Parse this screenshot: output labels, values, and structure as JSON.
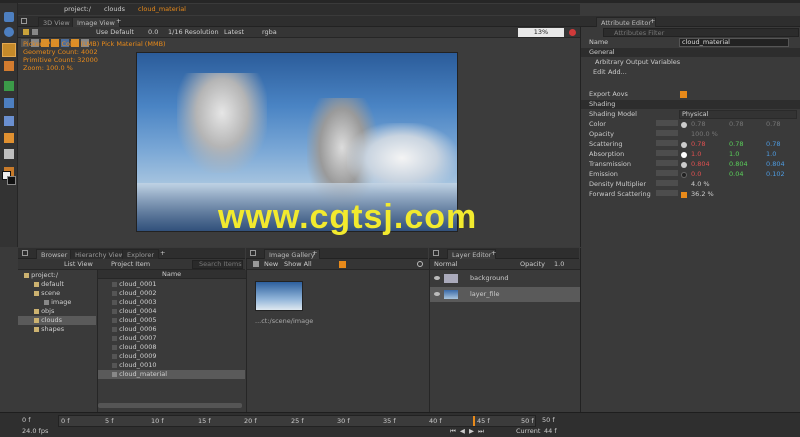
{
  "viewer": {
    "tabs": [
      "3D View",
      "Image View"
    ],
    "breadcrumb": [
      "project:/",
      "clouds",
      "cloud_material"
    ],
    "toolbar": {
      "shading": "Use Default",
      "exposure": "0.0",
      "resolution": "1/16 Resolution",
      "version": "Latest",
      "channels": "rgba",
      "zoom": "13%"
    },
    "overlay": [
      "Picker: Pick Color (LMB)  Pick Material (MMB)",
      "Geometry Count: 4002",
      "Primitive Count: 32000",
      "Zoom: 100.0 %"
    ],
    "watermark": "www.cgtsj.com"
  },
  "attribute_editor": {
    "tab": "Attribute Editor",
    "filter_placeholder": "Attributes Filter",
    "name_label": "Name",
    "name_value": "cloud_material",
    "general": "General",
    "aov": "Arbitrary Output Variables",
    "edit": "Edit",
    "add": "Add...",
    "export_aovs": "Export Aovs",
    "shading": "Shading",
    "shading_model_label": "Shading Model",
    "shading_model": "Physical",
    "rows": [
      {
        "label": "Color",
        "v1": "0.78",
        "v2": "0.78",
        "v3": "0.78",
        "dim": true
      },
      {
        "label": "Opacity",
        "v1": "100.0 %",
        "v2": "",
        "v3": "",
        "dim": true
      },
      {
        "label": "Scattering",
        "v1": "0.78",
        "v2": "0.78",
        "v3": "0.78"
      },
      {
        "label": "Absorption",
        "v1": "1.0",
        "v2": "1.0",
        "v3": "1.0"
      },
      {
        "label": "Transmission",
        "v1": "0.804",
        "v2": "0.804",
        "v3": "0.804"
      },
      {
        "label": "Emission",
        "v1": "0.0",
        "v2": "0.04",
        "v3": "0.102"
      },
      {
        "label": "Density Multiplier",
        "v1": "4.0 %",
        "v2": "",
        "v3": ""
      },
      {
        "label": "Forward Scattering",
        "v1": "36.2 %",
        "v2": "",
        "v3": ""
      }
    ],
    "colors": {
      "red": "#e05050",
      "green": "#5ad05a",
      "blue": "#4e9be0",
      "orange": "#e88a1a"
    }
  },
  "browser": {
    "tabs": [
      "Browser",
      "Hierarchy View",
      "Explorer"
    ],
    "list_view": "List View",
    "project_item": "Project Item",
    "search_placeholder": "Search Items",
    "col_name": "Name",
    "tree": [
      "project:/",
      "default",
      "scene",
      "image",
      "objs",
      "clouds",
      "shapes"
    ],
    "items": [
      "cloud_0001",
      "cloud_0002",
      "cloud_0003",
      "cloud_0004",
      "cloud_0005",
      "cloud_0006",
      "cloud_0007",
      "cloud_0008",
      "cloud_0009",
      "cloud_0010",
      "cloud_material"
    ]
  },
  "gallery": {
    "tab": "Image Gallery",
    "new": "New",
    "show": "Show All",
    "caption": "...ct:/scene/image"
  },
  "layer_editor": {
    "tab": "Layer Editor",
    "mode": "Normal",
    "opacity_label": "Opacity",
    "opacity": "1.0",
    "layers": [
      "background",
      "layer_file"
    ]
  },
  "timeline": {
    "start": "0 f",
    "fps": "24.0 fps",
    "ticks": [
      "0 f",
      "5 f",
      "10 f",
      "15 f",
      "20 f",
      "25 f",
      "30 f",
      "35 f",
      "40 f",
      "45 f",
      "50 f"
    ],
    "current_label": "Current",
    "current": "44 f",
    "end": "50 f",
    "end2": "50 f",
    "current_mark": "45 f"
  }
}
